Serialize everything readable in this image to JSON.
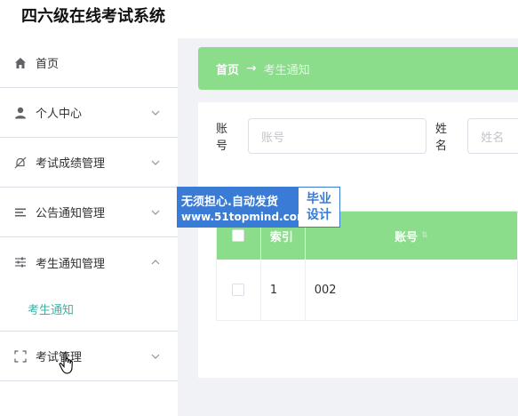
{
  "app": {
    "title": "四六级在线考试系统"
  },
  "sidebar": {
    "items": [
      {
        "label": "首页",
        "icon": "home-icon",
        "expandable": false
      },
      {
        "label": "个人中心",
        "icon": "user-icon",
        "expandable": true
      },
      {
        "label": "考试成绩管理",
        "icon": "bell-off-icon",
        "expandable": true
      },
      {
        "label": "公告通知管理",
        "icon": "list-icon",
        "expandable": true
      },
      {
        "label": "考生通知管理",
        "icon": "sliders-icon",
        "expandable": true,
        "expanded": true,
        "children": [
          {
            "label": "考生通知",
            "active": true
          }
        ]
      },
      {
        "label": "考试管理",
        "icon": "fullscreen-icon",
        "expandable": true
      }
    ]
  },
  "breadcrumb": {
    "home": "首页",
    "separator": "→",
    "current": "考生通知"
  },
  "search": {
    "account_label": "账号",
    "account_placeholder": "账号",
    "name_label": "姓名",
    "name_placeholder": "姓名"
  },
  "table": {
    "headers": {
      "index": "索引",
      "account": "账号"
    },
    "rows": [
      {
        "index": "1",
        "account": "002"
      }
    ]
  },
  "watermark": {
    "line1": "无须担心.自动发货",
    "line2": "www.51topmind.com",
    "side1": "毕业",
    "side2": "设计"
  },
  "colors": {
    "accent": "#8bdc8b",
    "active_menu": "#3bb3a4",
    "watermark": "#3a7bd5"
  }
}
